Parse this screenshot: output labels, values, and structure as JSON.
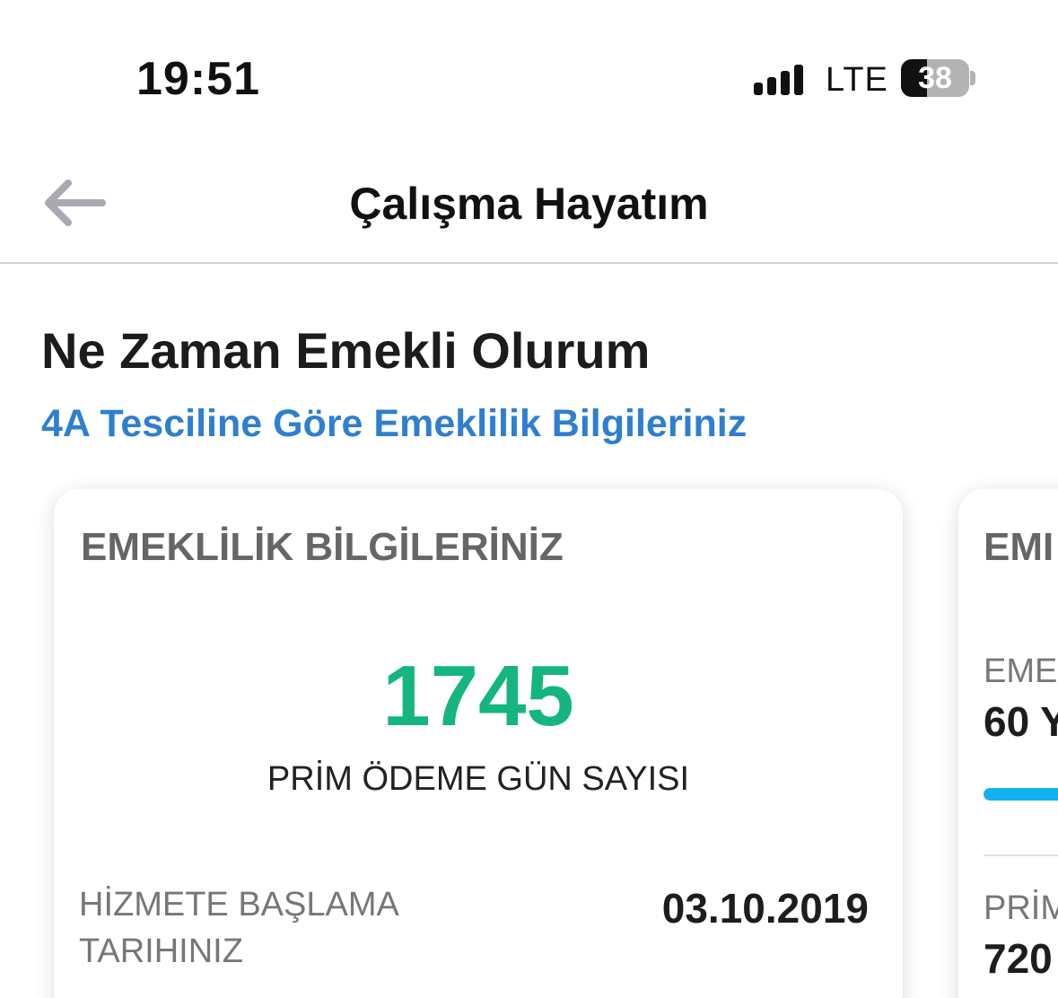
{
  "status_bar": {
    "time": "19:51",
    "network": "LTE",
    "battery_level": "38",
    "battery_fraction": 0.38,
    "signal_bars": 4,
    "icons": [
      "signal-icon",
      "battery-icon"
    ]
  },
  "nav": {
    "title": "Çalışma Hayatım",
    "back_icon": "arrow-left-icon"
  },
  "section": {
    "heading": "Ne Zaman Emekli Olurum",
    "subheading": "4A Tesciline Göre Emeklilik Bilgileriniz"
  },
  "cards": [
    {
      "title": "EMEKLİLİK BİLGİLERİNİZ",
      "big_number": "1745",
      "big_label": "PRİM ÖDEME GÜN SAYISI",
      "row_label": "HİZMETE BAŞLAMA TARIHINIZ",
      "row_value": "03.10.2019"
    },
    {
      "title": "EMI",
      "label1": "EME",
      "value1": "60 Y",
      "label2": "PRİM",
      "value2": "720"
    }
  ],
  "colors": {
    "accent_blue": "#2f7fd0",
    "number_green": "#15b57e",
    "progress_blue": "#12b2ee"
  }
}
